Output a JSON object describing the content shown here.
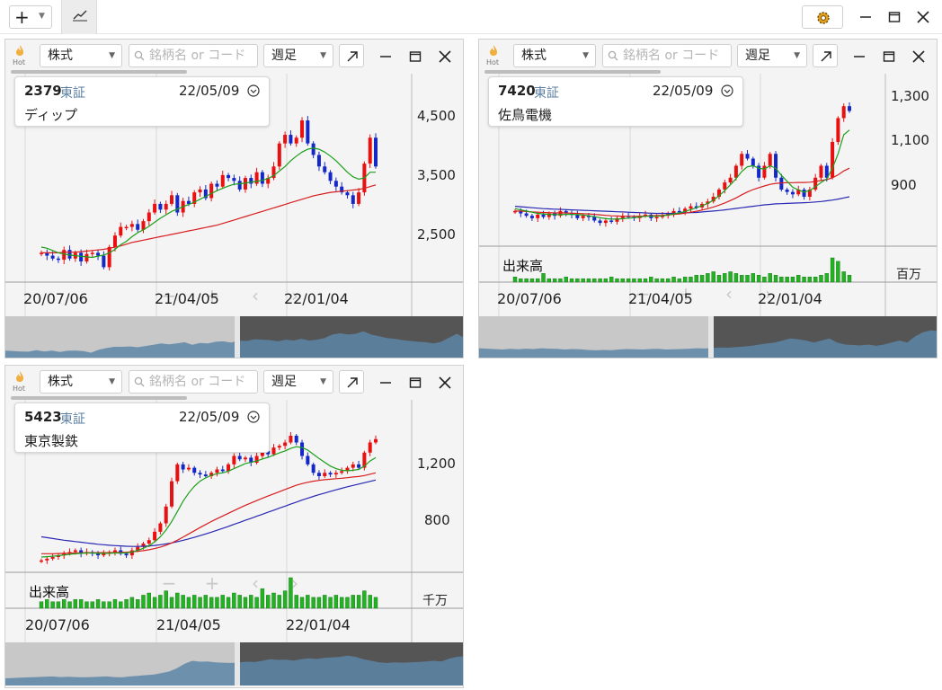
{
  "toolbar": {
    "add_icon": "plus-icon",
    "add_caret": "chevron-down-icon",
    "tab_icon": "chart-line-icon",
    "settings_icon": "gear-icon"
  },
  "colors": {
    "up": "#e81010",
    "down": "#1428c8",
    "ma_short": "#1aa01a",
    "ma_mid": "#d81e1e",
    "ma_long": "#2828b4",
    "volume": "#22b222"
  },
  "panels": [
    {
      "hot_label": "Hot",
      "market_select": "株式",
      "search_placeholder": "銘柄名 or コード",
      "period_select": "週足",
      "info": {
        "code": "2379",
        "exchange": "東証",
        "date": "22/05/09",
        "name": "ディップ"
      },
      "y_labels": [
        "4,500",
        "3,500",
        "2,500"
      ],
      "x_labels": [
        "20/07/06",
        "21/04/05",
        "22/01/04"
      ],
      "volume_label": "",
      "volume_unit": ""
    },
    {
      "hot_label": "Hot",
      "market_select": "株式",
      "search_placeholder": "銘柄名 or コード",
      "period_select": "週足",
      "info": {
        "code": "7420",
        "exchange": "東証",
        "date": "22/05/09",
        "name": "佐鳥電機"
      },
      "y_labels": [
        "1,300",
        "1,100",
        "900"
      ],
      "x_labels": [
        "20/07/06",
        "21/04/05",
        "22/01/04"
      ],
      "volume_label": "出来高",
      "volume_unit": "百万"
    },
    {
      "hot_label": "Hot",
      "market_select": "株式",
      "search_placeholder": "銘柄名 or コード",
      "period_select": "週足",
      "info": {
        "code": "5423",
        "exchange": "東証",
        "date": "22/05/09",
        "name": "東京製鉄"
      },
      "y_labels": [
        "1,200",
        "800"
      ],
      "x_labels": [
        "20/07/06",
        "21/04/05",
        "22/01/04"
      ],
      "volume_label": "出来高",
      "volume_unit": "千万"
    }
  ],
  "chart_data": [
    {
      "type": "candlestick",
      "title": "ディップ",
      "x": [
        "20/07/06",
        "21/04/05",
        "22/01/04"
      ],
      "ylim": [
        1900,
        5100
      ],
      "close": [
        2300,
        2250,
        2200,
        2180,
        2350,
        2200,
        2300,
        2150,
        2280,
        2300,
        2250,
        2050,
        2400,
        2600,
        2750,
        2750,
        2800,
        2700,
        2850,
        3000,
        3150,
        3050,
        3150,
        3300,
        3000,
        3200,
        3150,
        3350,
        3400,
        3250,
        3500,
        3450,
        3650,
        3600,
        3550,
        3400,
        3600,
        3500,
        3700,
        3500,
        3600,
        3800,
        4200,
        4350,
        4200,
        4300,
        4600,
        4200,
        4000,
        3800,
        3700,
        3550,
        3450,
        3350,
        3300,
        3150,
        3350,
        3850,
        4300,
        3800
      ],
      "ma_short": [
        2400,
        2380,
        2340,
        2300,
        2280,
        2260,
        2250,
        2240,
        2230,
        2220,
        2240,
        2260,
        2300,
        2360,
        2440,
        2500,
        2580,
        2650,
        2700,
        2760,
        2830,
        2900,
        2960,
        3020,
        3060,
        3100,
        3140,
        3180,
        3230,
        3280,
        3330,
        3380,
        3420,
        3460,
        3490,
        3500,
        3510,
        3530,
        3540,
        3560,
        3590,
        3640,
        3720,
        3800,
        3900,
        3980,
        4050,
        4100,
        4120,
        4100,
        4050,
        3980,
        3900,
        3800,
        3700,
        3620,
        3580,
        3600,
        3700,
        3700
      ],
      "ma_mid": [
        2300,
        2300,
        2300,
        2300,
        2310,
        2310,
        2310,
        2320,
        2330,
        2340,
        2350,
        2360,
        2380,
        2400,
        2420,
        2450,
        2480,
        2500,
        2520,
        2540,
        2560,
        2580,
        2600,
        2620,
        2640,
        2660,
        2680,
        2700,
        2720,
        2740,
        2760,
        2780,
        2810,
        2840,
        2870,
        2900,
        2930,
        2960,
        2990,
        3020,
        3050,
        3080,
        3110,
        3140,
        3170,
        3200,
        3230,
        3260,
        3290,
        3310,
        3330,
        3350,
        3360,
        3370,
        3380,
        3390,
        3400,
        3420,
        3450,
        3480
      ]
    },
    {
      "type": "candlestick",
      "title": "佐鳥電機",
      "x": [
        "20/07/06",
        "21/04/05",
        "22/01/04"
      ],
      "ylim": [
        720,
        1380
      ],
      "close": [
        860,
        850,
        840,
        830,
        845,
        835,
        850,
        840,
        860,
        850,
        845,
        830,
        840,
        835,
        820,
        810,
        820,
        815,
        830,
        840,
        835,
        830,
        840,
        845,
        830,
        835,
        840,
        850,
        860,
        855,
        870,
        880,
        875,
        890,
        900,
        920,
        950,
        980,
        1000,
        1050,
        1100,
        1080,
        1050,
        1000,
        1050,
        1100,
        1000,
        950,
        940,
        930,
        950,
        920,
        950,
        1000,
        1050,
        1000,
        1150,
        1250,
        1300,
        1280
      ],
      "ma_short": [
        870,
        865,
        860,
        855,
        850,
        848,
        846,
        845,
        845,
        846,
        846,
        845,
        843,
        840,
        836,
        832,
        828,
        826,
        826,
        828,
        830,
        832,
        835,
        838,
        838,
        838,
        840,
        843,
        848,
        852,
        858,
        866,
        874,
        882,
        892,
        906,
        924,
        946,
        970,
        996,
        1026,
        1046,
        1050,
        1040,
        1036,
        1050,
        1040,
        1010,
        985,
        960,
        948,
        940,
        946,
        962,
        980,
        995,
        1040,
        1100,
        1180,
        1200
      ],
      "ma_mid": [
        860,
        860,
        858,
        856,
        855,
        854,
        853,
        852,
        852,
        852,
        851,
        850,
        849,
        848,
        846,
        844,
        842,
        840,
        839,
        838,
        838,
        838,
        838,
        839,
        840,
        841,
        842,
        844,
        846,
        848,
        851,
        855,
        859,
        864,
        870,
        877,
        885,
        894,
        904,
        915,
        928,
        940,
        950,
        958,
        965,
        972,
        976,
        978,
        979,
        979,
        980,
        980,
        981,
        984,
        988,
        992,
        1000,
        1012,
        1028,
        1040
      ],
      "ma_long": [
        880,
        878,
        876,
        874,
        872,
        870,
        869,
        868,
        867,
        866,
        865,
        864,
        863,
        862,
        861,
        860,
        859,
        858,
        857,
        856,
        855,
        854,
        853,
        852,
        851,
        850,
        850,
        850,
        850,
        851,
        852,
        853,
        854,
        856,
        858,
        860,
        862,
        865,
        868,
        871,
        874,
        877,
        880,
        883,
        886,
        888,
        890,
        891,
        892,
        893,
        894,
        895,
        896,
        898,
        900,
        903,
        906,
        910,
        915,
        920
      ],
      "volume": [
        3,
        2,
        2,
        2,
        2,
        5,
        2,
        2,
        2,
        3,
        2,
        2,
        2,
        2,
        2,
        2,
        2,
        3,
        2,
        2,
        2,
        2,
        2,
        2,
        3,
        2,
        2,
        2,
        3,
        2,
        3,
        3,
        4,
        4,
        5,
        6,
        4,
        5,
        6,
        5,
        4,
        4,
        5,
        4,
        3,
        5,
        4,
        3,
        3,
        3,
        4,
        3,
        3,
        3,
        4,
        5,
        14,
        12,
        6,
        4
      ]
    },
    {
      "type": "candlestick",
      "title": "東京製鉄",
      "x": [
        "20/07/06",
        "21/04/05",
        "22/01/04"
      ],
      "ylim": [
        620,
        1500
      ],
      "close": [
        680,
        690,
        700,
        710,
        720,
        730,
        740,
        720,
        730,
        720,
        710,
        720,
        730,
        740,
        720,
        710,
        740,
        760,
        780,
        800,
        850,
        900,
        1000,
        1150,
        1250,
        1220,
        1230,
        1200,
        1190,
        1180,
        1200,
        1220,
        1210,
        1250,
        1300,
        1280,
        1290,
        1260,
        1300,
        1330,
        1310,
        1350,
        1360,
        1380,
        1420,
        1380,
        1300,
        1250,
        1200,
        1180,
        1200,
        1190,
        1200,
        1210,
        1230,
        1250,
        1230,
        1320,
        1380,
        1400
      ],
      "ma_short": [
        700,
        702,
        705,
        708,
        712,
        716,
        720,
        722,
        724,
        724,
        722,
        722,
        722,
        724,
        724,
        724,
        730,
        740,
        752,
        768,
        790,
        820,
        860,
        910,
        970,
        1030,
        1080,
        1120,
        1150,
        1170,
        1185,
        1195,
        1200,
        1210,
        1225,
        1240,
        1255,
        1262,
        1270,
        1282,
        1292,
        1305,
        1318,
        1330,
        1345,
        1355,
        1350,
        1335,
        1310,
        1285,
        1262,
        1240,
        1225,
        1215,
        1212,
        1215,
        1220,
        1240,
        1270,
        1290
      ],
      "ma_mid": [
        720,
        720,
        720,
        721,
        722,
        723,
        724,
        725,
        726,
        726,
        726,
        726,
        726,
        727,
        728,
        729,
        731,
        734,
        738,
        743,
        750,
        759,
        770,
        784,
        800,
        818,
        837,
        856,
        875,
        893,
        911,
        928,
        944,
        960,
        976,
        992,
        1007,
        1021,
        1035,
        1049,
        1062,
        1075,
        1088,
        1101,
        1114,
        1126,
        1136,
        1144,
        1150,
        1155,
        1159,
        1162,
        1165,
        1168,
        1171,
        1175,
        1178,
        1184,
        1192,
        1200
      ],
      "ma_long": [
        820,
        815,
        810,
        805,
        800,
        796,
        792,
        788,
        784,
        780,
        776,
        773,
        770,
        768,
        766,
        764,
        763,
        763,
        764,
        766,
        769,
        773,
        778,
        784,
        791,
        799,
        808,
        817,
        827,
        837,
        848,
        859,
        870,
        882,
        894,
        906,
        918,
        930,
        942,
        954,
        966,
        978,
        990,
        1002,
        1014,
        1026,
        1038,
        1049,
        1060,
        1070,
        1080,
        1090,
        1099,
        1108,
        1117,
        1125,
        1133,
        1141,
        1149,
        1157
      ],
      "volume": [
        3,
        4,
        3,
        3,
        4,
        3,
        4,
        4,
        3,
        3,
        4,
        3,
        3,
        4,
        3,
        4,
        5,
        4,
        6,
        7,
        5,
        6,
        8,
        5,
        7,
        6,
        5,
        6,
        5,
        6,
        5,
        5,
        6,
        5,
        7,
        6,
        5,
        6,
        5,
        9,
        6,
        7,
        6,
        8,
        14,
        6,
        5,
        6,
        5,
        5,
        6,
        5,
        6,
        5,
        5,
        6,
        6,
        8,
        6,
        5
      ]
    }
  ]
}
